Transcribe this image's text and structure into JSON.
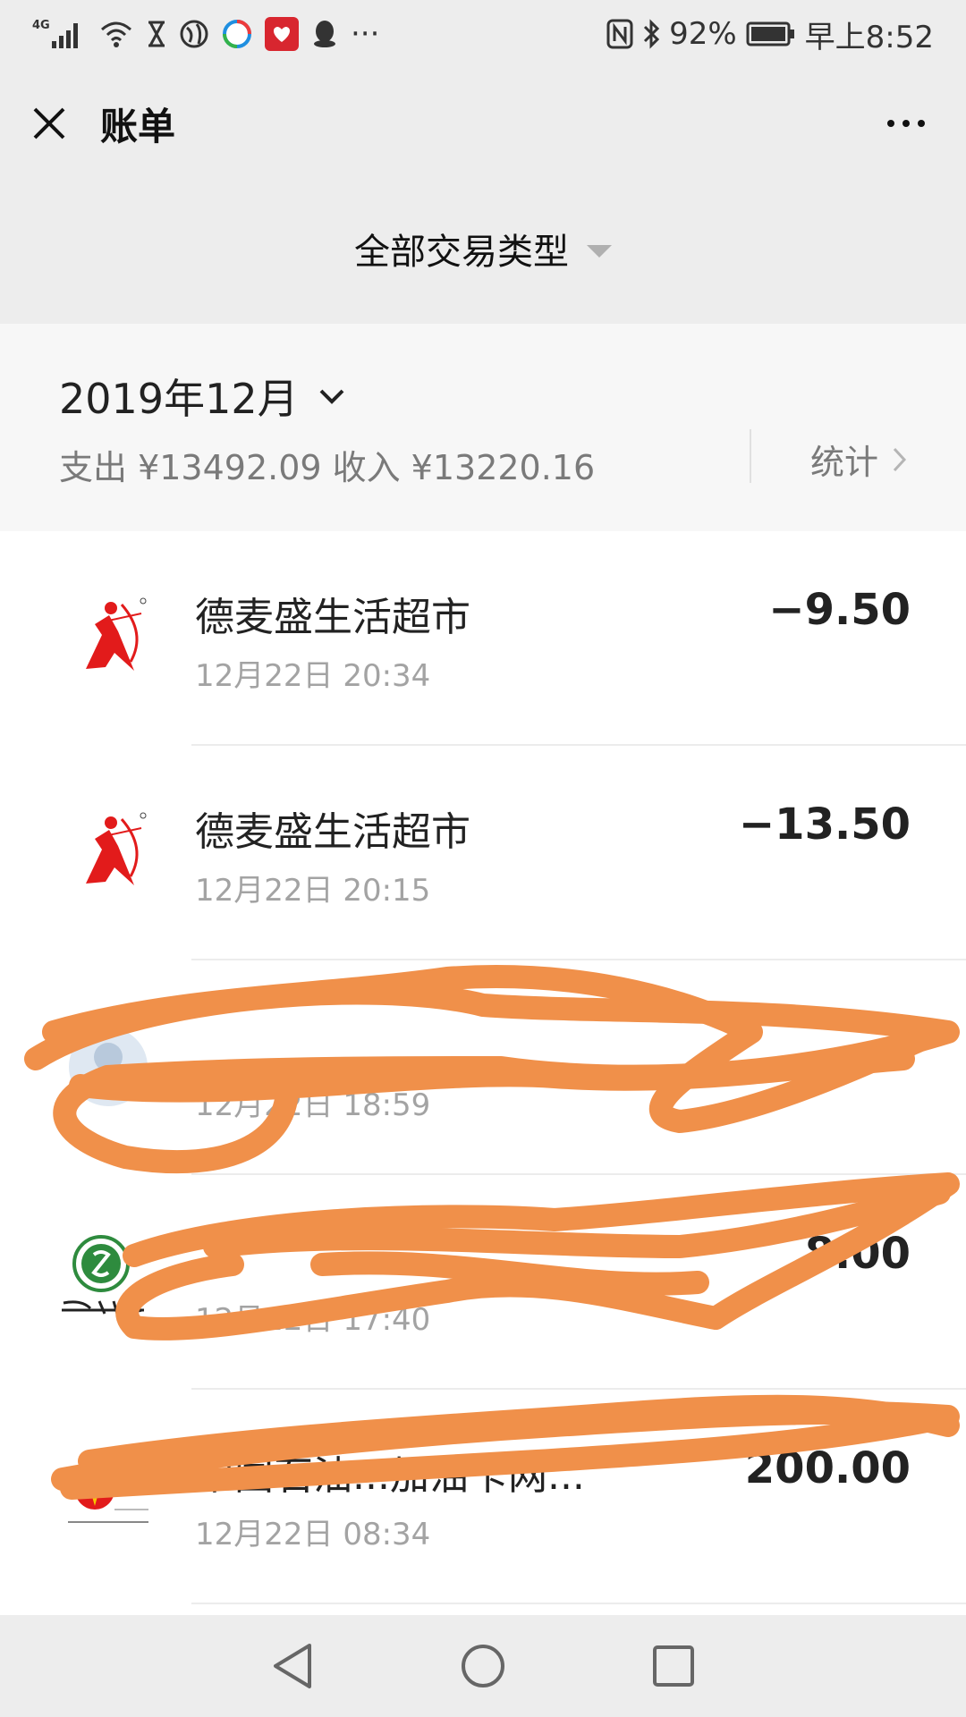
{
  "status_bar": {
    "network": "4G",
    "battery_text": "92%",
    "time": "早上8:52",
    "more": "···"
  },
  "header": {
    "title": "账单"
  },
  "filter": {
    "label": "全部交易类型"
  },
  "summary": {
    "month": "2019年12月",
    "expense": "支出 ¥13492.09",
    "income": "收入 ¥13220.16",
    "stats_label": "统计"
  },
  "transactions": [
    {
      "merchant": "德麦盛生活超市",
      "time": "12月22日 20:34",
      "amount": "−9.50",
      "icon": "archer-logo-icon"
    },
    {
      "merchant": "德麦盛生活超市",
      "time": "12月22日 20:15",
      "amount": "−13.50",
      "icon": "archer-logo-icon"
    },
    {
      "merchant": "",
      "time": "12月22日 18:59",
      "amount": "",
      "icon": "avatar-icon"
    },
    {
      "merchant": "",
      "time": "12月22日 17:40",
      "amount": "8.00",
      "icon": "sichuan-rural-credit-logo-icon"
    },
    {
      "merchant": "中国石油...加油卡网...",
      "time": "12月22日 08:34",
      "amount": "200.00",
      "icon": "petrochina-logo-icon"
    }
  ],
  "colors": {
    "background": "#ededed",
    "list_bg": "#ffffff",
    "scribble": "#f0904a",
    "logo_red": "#e21b1b"
  }
}
